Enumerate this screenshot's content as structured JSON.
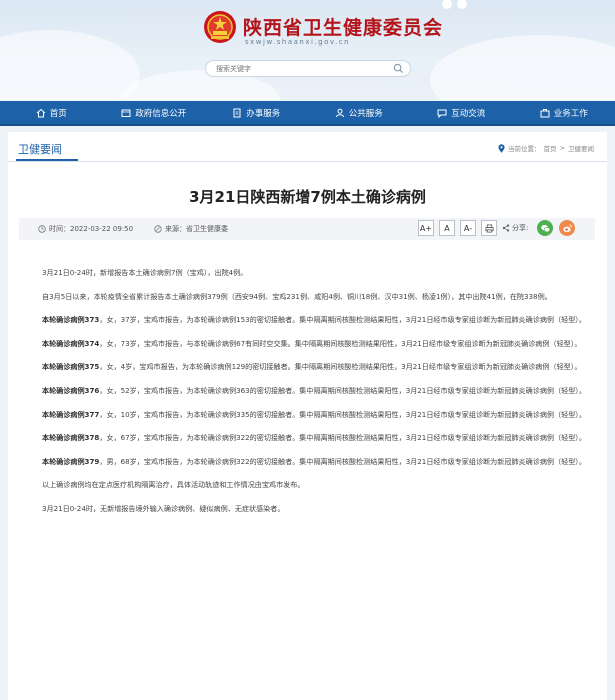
{
  "site": {
    "title": "陕西省卫生健康委员会",
    "url": "sxwjw.shaanxi.gov.cn",
    "search_placeholder": "搜索关键字"
  },
  "nav": {
    "items": [
      {
        "label": "首页",
        "icon": "home-icon"
      },
      {
        "label": "政府信息公开",
        "icon": "folder-icon"
      },
      {
        "label": "办事服务",
        "icon": "document-icon"
      },
      {
        "label": "公共服务",
        "icon": "people-icon"
      },
      {
        "label": "互动交流",
        "icon": "chat-icon"
      },
      {
        "label": "业务工作",
        "icon": "briefcase-icon"
      }
    ]
  },
  "section": {
    "title": "卫健要闻",
    "breadcrumb_prefix": "当前位置：",
    "breadcrumb_home": "首页",
    "breadcrumb_sep": ">",
    "breadcrumb_current": "卫健要闻"
  },
  "article": {
    "title": "3月21日陕西新增7例本土确诊病例",
    "time": "时间：2022-03-22 09:50",
    "source": "来源：省卫生健康委",
    "share_label": "分享:",
    "tools": [
      "A+",
      "A",
      "A-",
      "print"
    ],
    "paragraphs": {
      "p1": "3月21日0-24时，新增报告本土确诊病例7例（宝鸡），出院4例。",
      "p2": "自3月5日以来，本轮疫情全省累计报告本土确诊病例379例（西安94例、宝鸡231例、咸阳4例、铜川18例、汉中31例、杨凌1例），其中出院41例，在院338例。",
      "cases": [
        {
          "label": "本轮确诊病例373",
          "text": "，女，37岁，宝鸡市报告，为本轮确诊病例153的密切接触者。集中隔离期间核酸检测结果阳性，3月21日经市级专家组诊断为新冠肺炎确诊病例（轻型）。"
        },
        {
          "label": "本轮确诊病例374",
          "text": "，女，73岁，宝鸡市报告，与本轮确诊病例67有同时空交集。集中隔离期间核酸检测结果阳性，3月21日经市级专家组诊断为新冠肺炎确诊病例（轻型）。"
        },
        {
          "label": "本轮确诊病例375",
          "text": "，女，4岁，宝鸡市报告，为本轮确诊病例129的密切接触者。集中隔离期间核酸检测结果阳性，3月21日经市级专家组诊断为新冠肺炎确诊病例（轻型）。"
        },
        {
          "label": "本轮确诊病例376",
          "text": "，女，52岁，宝鸡市报告，为本轮确诊病例363的密切接触者。集中隔离期间核酸检测结果阳性，3月21日经市级专家组诊断为新冠肺炎确诊病例（轻型）。"
        },
        {
          "label": "本轮确诊病例377",
          "text": "，女，10岁，宝鸡市报告，为本轮确诊病例335的密切接触者。集中隔离期间核酸检测结果阳性，3月21日经市级专家组诊断为新冠肺炎确诊病例（轻型）。"
        },
        {
          "label": "本轮确诊病例378",
          "text": "，女，67岁，宝鸡市报告，为本轮确诊病例322的密切接触者。集中隔离期间核酸检测结果阳性，3月21日经市级专家组诊断为新冠肺炎确诊病例（轻型）。"
        },
        {
          "label": "本轮确诊病例379",
          "text": "，男，68岁，宝鸡市报告，为本轮确诊病例322的密切接触者。集中隔离期间核酸检测结果阳性，3月21日经市级专家组诊断为新冠肺炎确诊病例（轻型）。"
        }
      ],
      "p10": "以上确诊病例均在定点医疗机构隔离治疗，具体活动轨迹和工作情况由宝鸡市发布。",
      "p11": "3月21日0-24时，无新增报告境外输入确诊病例、疑似病例、无症状感染者。"
    }
  },
  "colors": {
    "nav_blue": "#1d62a8",
    "title_red": "#b3141a",
    "wechat_green": "#4caf50",
    "weibo_orange": "#f08a4b"
  }
}
